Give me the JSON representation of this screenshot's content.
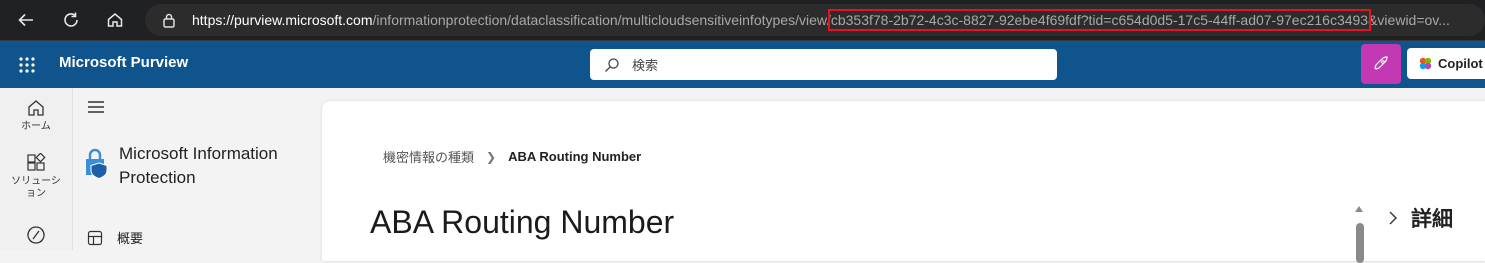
{
  "browser": {
    "url_host": "https://purview.microsoft.com",
    "url_path": "/informationprotection/dataclassification/multicloudsensitiveinfotypes/view/",
    "url_highlight": "cb353f78-2b72-4c3c-8827-92ebe4f69fdf?tid=c654d0d5-17c5-44ff-ad07-97ec216c3493",
    "url_tail": "&viewid=ov..."
  },
  "header": {
    "title": "Microsoft Purview",
    "search_placeholder": "検索",
    "copilot_label": "Copilot",
    "accent": "#0f548c",
    "pink_button_color": "#c239b3"
  },
  "rail": {
    "items": [
      {
        "label": "ホーム",
        "icon": "home-icon"
      },
      {
        "label": "ソリューション",
        "icon": "solutions-icon"
      },
      {
        "label": "",
        "icon": "policy-icon"
      }
    ]
  },
  "nav": {
    "solution_title": "Microsoft Information Protection",
    "overview_label": "概要"
  },
  "main": {
    "breadcrumb": [
      "機密情報の種類",
      "ABA Routing Number"
    ],
    "title": "ABA Routing Number",
    "details_label": "詳細"
  }
}
